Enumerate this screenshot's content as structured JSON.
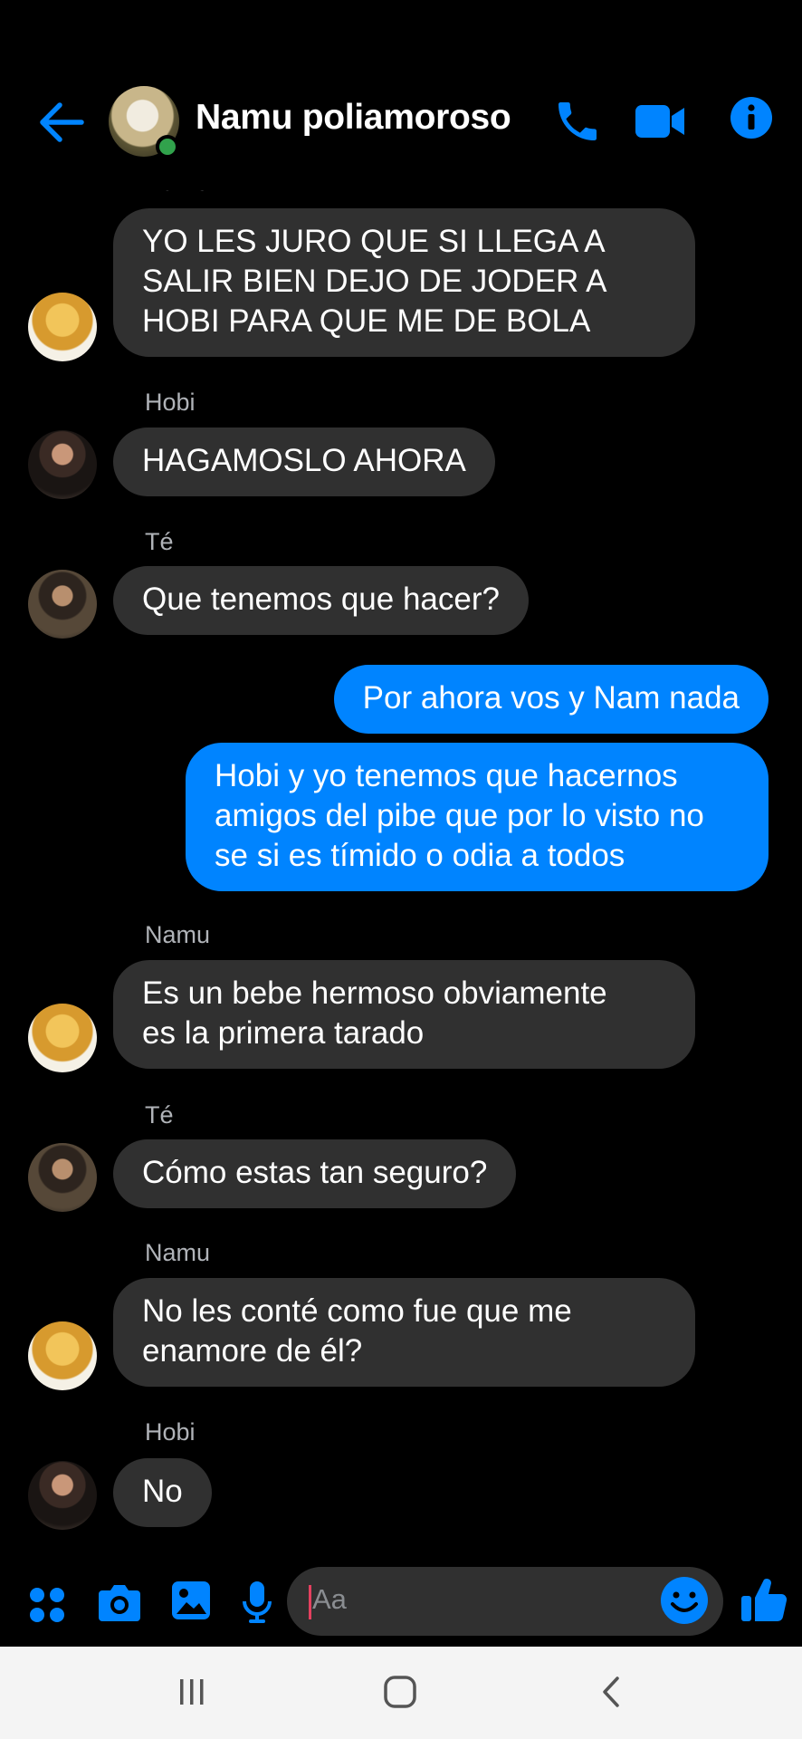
{
  "header": {
    "title": "Namu poliamoroso",
    "accent": "#0084ff",
    "online_color": "#31a24c"
  },
  "messages": [
    {
      "sender": "Namu",
      "text": "YO LES JURO QUE SI LLEGA A\nSALIR BIEN DEJO DE JODER A\nHOBI PARA QUE ME DE BOLA",
      "direction": "in"
    },
    {
      "sender": "Hobi",
      "text": "HAGAMOSLO AHORA",
      "direction": "in"
    },
    {
      "sender": "Té",
      "text": "Que tenemos que hacer?",
      "direction": "in"
    },
    {
      "text": "Por ahora vos y Nam nada",
      "direction": "out"
    },
    {
      "text": "Hobi y yo tenemos que hacernos\namigos del pibe que por lo visto no\nse si es tímido o odia a todos",
      "direction": "out"
    },
    {
      "sender": "Namu",
      "text": "Es un bebe hermoso obviamente\nes la primera tarado",
      "direction": "in"
    },
    {
      "sender": "Té",
      "text": "Cómo estas tan seguro?",
      "direction": "in"
    },
    {
      "sender": "Namu",
      "text": "No les conté como fue que me\nenamore de él?",
      "direction": "in"
    },
    {
      "sender": "Hobi",
      "text": "No",
      "direction": "in"
    }
  ],
  "composer": {
    "placeholder": "Aa",
    "icons": [
      "apps-icon",
      "camera-icon",
      "gallery-icon",
      "microphone-icon",
      "emoji-icon",
      "thumbs-up-icon"
    ]
  },
  "navbar": {
    "buttons": [
      "recent-apps-icon",
      "home-icon",
      "back-icon"
    ]
  }
}
